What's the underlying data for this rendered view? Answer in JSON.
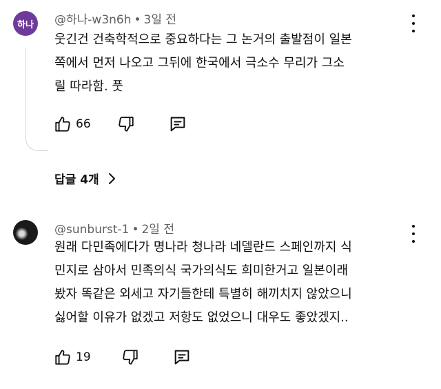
{
  "comments": [
    {
      "avatar_text": "하나",
      "handle": "@하나-w3n6h",
      "time": "3일 전",
      "lines": [
        "웃긴건 건축학적으로 중요하다는 그 논거의 출발점이 일본",
        "쪽에서 먼저 나오고 그뒤에 한국에서 극소수 무리가 그소",
        "릴 따라함. 풋"
      ],
      "likes": "66",
      "replies_label": "답글 4개"
    },
    {
      "avatar_text": "",
      "handle": "@sunburst-1",
      "time": "2일 전",
      "lines": [
        "원래 다민족에다가 명나라 청나라 네델란드 스페인까지 식",
        "민지로 삼아서 민족의식 국가의식도 희미한거고 일본이래",
        "봤자 똑같은 외세고 자기들한테 특별히 해끼치지 않았으니",
        "싫어할 이유가 없겠고 저항도 없었으니 대우도 좋았겠지.."
      ],
      "likes": "19"
    }
  ],
  "colors": {
    "avatar_bg": "#6e3b9a",
    "meta_text": "#606060",
    "text": "#0f0f0f",
    "thread_line": "#d6d6d6"
  },
  "icons": [
    "thumbs-up-icon",
    "thumbs-down-icon",
    "reply-comment-icon",
    "more-vert-icon",
    "chevron-right-icon"
  ]
}
